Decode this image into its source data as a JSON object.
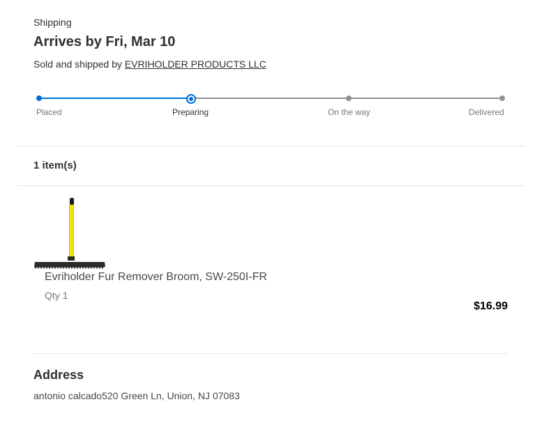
{
  "shipping": {
    "section_label": "Shipping",
    "arrives": "Arrives by Fri, Mar 10",
    "sold_prefix": "Sold and shipped by ",
    "seller": "EVRIHOLDER PRODUCTS LLC"
  },
  "tracker": {
    "steps": [
      {
        "label": "Placed",
        "state": "done"
      },
      {
        "label": "Preparing",
        "state": "current"
      },
      {
        "label": "On the way",
        "state": "todo"
      },
      {
        "label": "Delivered",
        "state": "todo"
      }
    ],
    "progress_fraction": 0.33
  },
  "items": {
    "count_label": "1 item(s)",
    "list": [
      {
        "image_icon": "broom-product-image",
        "name": "Evriholder Fur Remover Broom, SW-250I-FR",
        "qty": "Qty 1",
        "price": "$16.99"
      }
    ]
  },
  "address": {
    "title": "Address",
    "text": "antonio calcado520 Green Ln, Union, NJ 07083"
  },
  "colors": {
    "accent": "#0071dc",
    "inactive": "#909196",
    "divider": "#e3e4e5"
  }
}
